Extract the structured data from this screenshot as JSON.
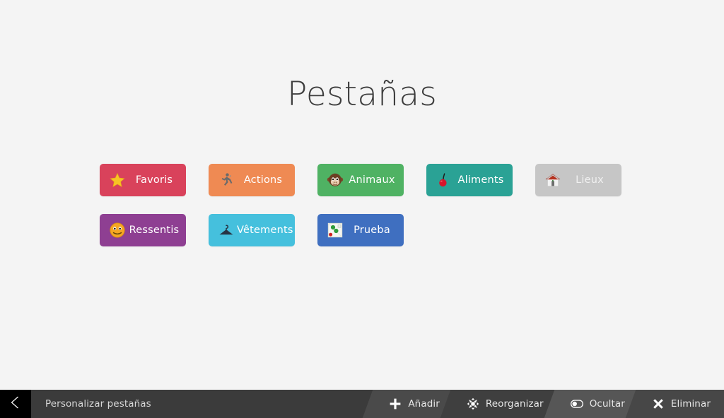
{
  "page": {
    "title": "Pestañas",
    "background_color": "#f4f4f4"
  },
  "tabs": {
    "rows": [
      [
        {
          "label": "Favoris",
          "icon": "star-icon",
          "color": "#d9425b",
          "state": "visible"
        },
        {
          "label": "Actions",
          "icon": "runner-icon",
          "color": "#ef8a53",
          "state": "visible"
        },
        {
          "label": "Animaux",
          "icon": "monkey-icon",
          "color": "#4fb263",
          "state": "visible"
        },
        {
          "label": "Aliments",
          "icon": "cherry-icon",
          "color": "#2aa295",
          "state": "visible"
        },
        {
          "label": "Lieux",
          "icon": "house-icon",
          "color": "#c6c6c6",
          "state": "hidden"
        }
      ],
      [
        {
          "label": "Ressentis",
          "icon": "smiley-icon",
          "color": "#8e3f92",
          "state": "visible"
        },
        {
          "label": "Vêtements",
          "icon": "hanger-icon",
          "color": "#45c0dd",
          "state": "visible"
        },
        {
          "label": "Prueba",
          "icon": "photo-icon",
          "color": "#3f6fc0",
          "state": "visible"
        }
      ]
    ]
  },
  "toolbar": {
    "back_label": "back-chevron",
    "title": "Personalizar pestañas",
    "actions": [
      {
        "label": "Añadir",
        "icon": "plus-icon"
      },
      {
        "label": "Reorganizar",
        "icon": "move-icon"
      },
      {
        "label": "Ocultar",
        "icon": "toggle-off-icon"
      },
      {
        "label": "Eliminar",
        "icon": "close-x-icon"
      }
    ]
  }
}
